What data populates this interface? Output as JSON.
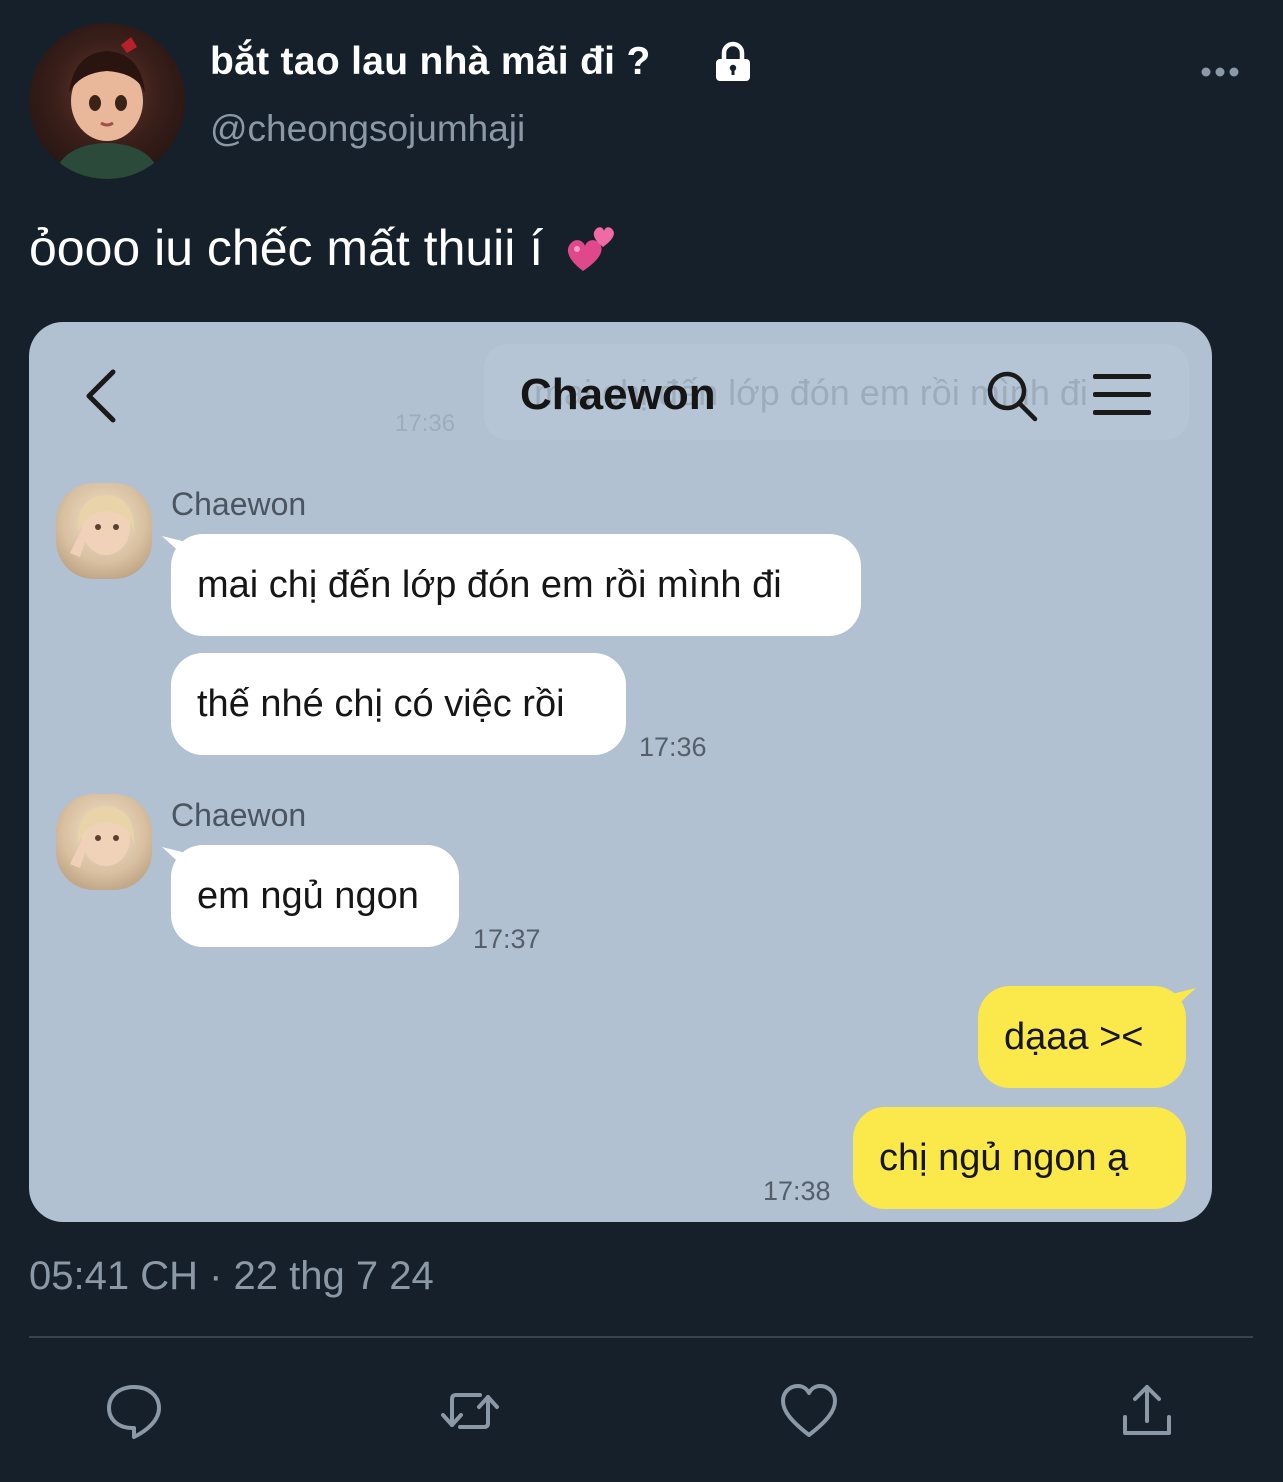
{
  "author": {
    "display_name": "bắt tao lau nhà mãi đi ?",
    "handle": "@cheongsojumhaji",
    "protected_icon": "lock-icon"
  },
  "tweet": {
    "text": "ỏooo iu chếc mất thuii í",
    "emoji": "two-hearts-emoji",
    "timestamp": "05:41 CH · 22 thg 7 24"
  },
  "chat": {
    "title": "Chaewon",
    "background_color": "#b1c1d2",
    "ghost_text": "mai chị đến lớp đón em rồi mình đi",
    "ghost_time": "17:36",
    "groups": [
      {
        "sender": "Chaewon",
        "messages": [
          "mai chị đến lớp đón em rồi mình đi",
          "thế nhé chị có việc rồi"
        ],
        "time": "17:36"
      },
      {
        "sender": "Chaewon",
        "messages": [
          "em ngủ ngon"
        ],
        "time": "17:37"
      }
    ],
    "outgoing": {
      "messages": [
        "dạaa ><",
        "chị ngủ ngon ạ"
      ],
      "time": "17:38",
      "bubble_color": "#fbe84b"
    }
  },
  "actions": [
    "reply-icon",
    "retweet-icon",
    "like-icon",
    "share-icon"
  ],
  "theme": {
    "background": "#15202b",
    "secondary_text": "#8b98a5",
    "divider": "#38444d"
  }
}
